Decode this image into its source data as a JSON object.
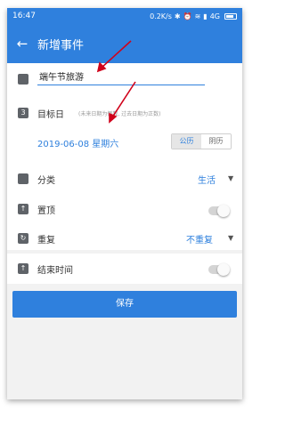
{
  "status_bar": {
    "time": "16:47",
    "network_speed": "0.2K/s",
    "network_type": "4G",
    "icons": [
      "bluetooth-icon",
      "alarm-icon",
      "wifi-icon",
      "signal-icon",
      "battery-icon"
    ]
  },
  "app_bar": {
    "back_icon": "back-arrow-icon",
    "title": "新增事件"
  },
  "form": {
    "name_value": "端午节旅游",
    "target_date": {
      "label": "目标日",
      "hint": "(未来日期为倒数, 过去日期为正数)",
      "date_value": "2019-06-08 星期六",
      "calendar_options": [
        "公历",
        "阴历"
      ],
      "selected_calendar": "公历"
    },
    "category": {
      "label": "分类",
      "value": "生活"
    },
    "pin_top": {
      "label": "置顶",
      "enabled": false
    },
    "repeat": {
      "label": "重复",
      "value": "不重复"
    },
    "end_time": {
      "label": "结束时间",
      "enabled": false
    }
  },
  "save_label": "保存",
  "colors": {
    "accent": "#2f80dd",
    "background": "#f2f2f2",
    "annotation_arrow": "#d0021b"
  }
}
